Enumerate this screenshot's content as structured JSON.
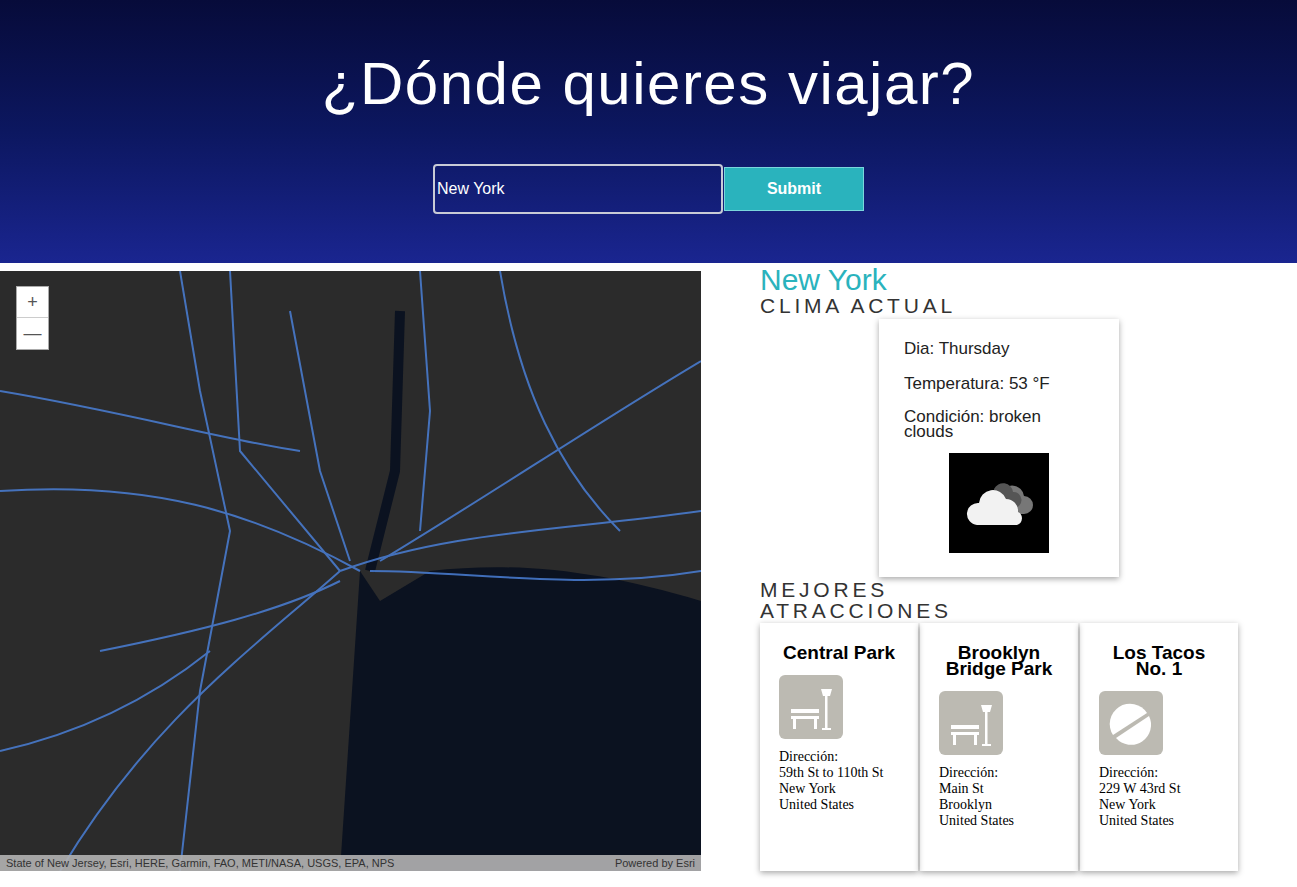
{
  "header": {
    "title": "¿Dónde quieres viajar?"
  },
  "search": {
    "value": "New York",
    "button": "Submit"
  },
  "map": {
    "zoom": [
      "+",
      "—"
    ],
    "attribution": "State of New Jersey, Esri, HERE, Garmin, FAO, METI/NASA, USGS, EPA, NPS",
    "powered": "Powered by Esri"
  },
  "weather": {
    "city": "New York",
    "section": "CLIMA ACTUAL",
    "day": "Dia: Thursday",
    "temperature": "Temperatura: 53 °F",
    "condition": "Condición: broken clouds"
  },
  "attractions": {
    "heading": "MEJORES ATRACCIONES",
    "items": [
      {
        "name": "Central Park",
        "kind": "park",
        "address": [
          "Dirección:",
          "59th St to 110th St",
          "New York",
          "United States"
        ]
      },
      {
        "name": "Brooklyn Bridge Park",
        "kind": "park",
        "address": [
          "Dirección:",
          "Main St",
          "Brooklyn",
          "United States"
        ]
      },
      {
        "name": "Los Tacos No. 1",
        "kind": "food",
        "address": [
          "Dirección:",
          "229 W 43rd St",
          "New York",
          "United States"
        ]
      }
    ]
  }
}
